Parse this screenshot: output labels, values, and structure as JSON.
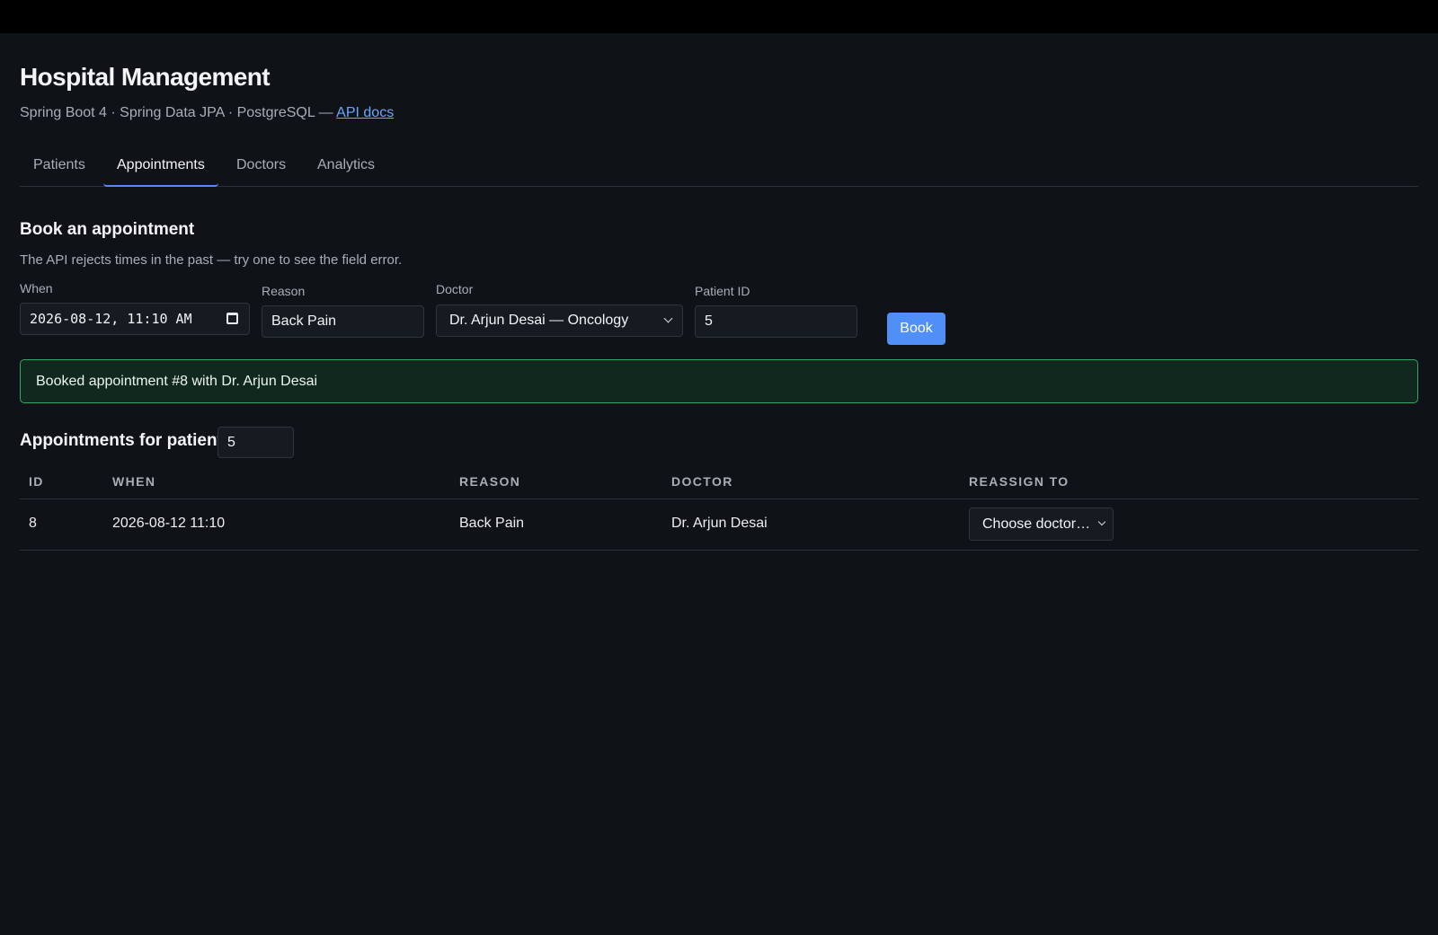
{
  "app": {
    "title": "Hospital Management",
    "subtitle_prefix": "Spring Boot 4 · Spring Data JPA · PostgreSQL — ",
    "subtitle_link": "API docs"
  },
  "tabs": [
    {
      "label": "Patients",
      "active": false
    },
    {
      "label": "Appointments",
      "active": true
    },
    {
      "label": "Doctors",
      "active": false
    },
    {
      "label": "Analytics",
      "active": false
    }
  ],
  "booking": {
    "title": "Book an appointment",
    "hint": "The API rejects times in the past — try one to see the field error.",
    "when_label": "When",
    "when_value": "2026-08-12, 11:10 AM",
    "reason_label": "Reason",
    "reason_value": "Back Pain",
    "doctor_label": "Doctor",
    "doctor_value": "Dr. Arjun Desai — Oncology",
    "patient_label": "Patient ID",
    "patient_value": "5",
    "book_label": "Book"
  },
  "alert": {
    "message": "Booked appointment #8 with Dr. Arjun Desai",
    "color": "#36a466"
  },
  "appointments": {
    "title": "Appointments for patient",
    "patient_value": "5",
    "columns": [
      "ID",
      "WHEN",
      "REASON",
      "DOCTOR",
      "REASSIGN TO"
    ],
    "rows": [
      {
        "id": "8",
        "when": "2026-08-12 11:10",
        "reason": "Back Pain",
        "doctor": "Dr. Arjun Desai",
        "reassign": "Choose doctor…"
      }
    ]
  },
  "colors": {
    "background": "#0f1217",
    "accent": "#4f8ff7",
    "link": "#6aa6ff"
  }
}
